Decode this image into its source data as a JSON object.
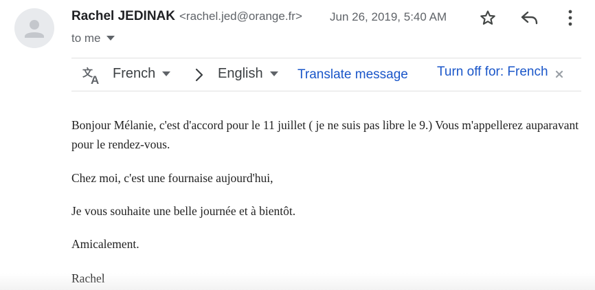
{
  "header": {
    "sender_name": "Rachel JEDINAK",
    "sender_email": "<rachel.jed@orange.fr>",
    "timestamp": "Jun 26, 2019, 5:40 AM",
    "recipient": "to me",
    "icons": {
      "avatar": "person-icon",
      "star": "star-outline-icon",
      "reply": "reply-icon",
      "more": "more-vertical-icon",
      "recipient_dropdown": "chevron-down-icon"
    }
  },
  "translate_bar": {
    "from_language": "French",
    "to_language": "English",
    "translate_label": "Translate message",
    "turn_off_label": "Turn off for: French",
    "icons": {
      "translate": "translate-icon",
      "arrow": "chevron-right-icon",
      "close": "close-icon"
    }
  },
  "message": {
    "paragraphs": [
      "Bonjour Mélanie,  c'est d'accord pour le 11 juillet ( je ne suis pas libre le 9.) Vous m'appellerez auparavant pour le rendez-vous.",
      "Chez moi, c'est une fournaise aujourd'hui,",
      "Je vous souhaite une belle journée et à bientôt.",
      "Amicalement.",
      "Rachel"
    ]
  },
  "colors": {
    "link": "#1a56c9",
    "secondary_text": "#5f6368",
    "avatar_bg": "#e8eaed"
  }
}
